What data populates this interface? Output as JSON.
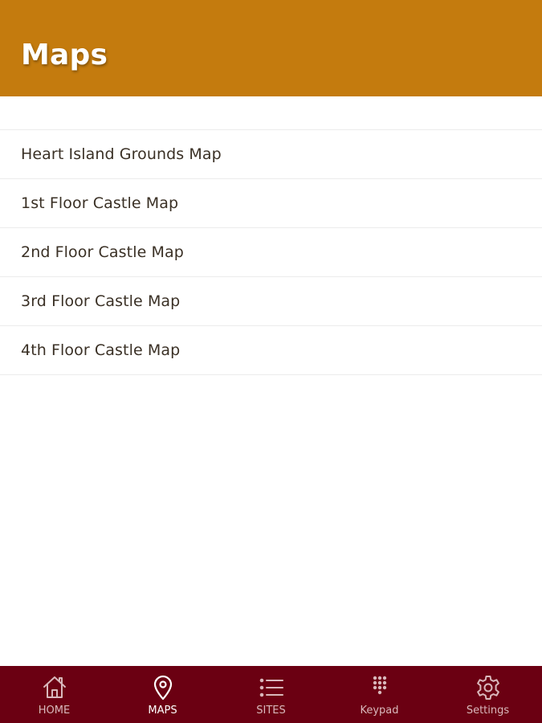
{
  "header": {
    "title": "Maps"
  },
  "maps": {
    "items": [
      {
        "label": "Heart Island Grounds Map"
      },
      {
        "label": "1st Floor Castle Map"
      },
      {
        "label": "2nd Floor Castle Map"
      },
      {
        "label": "3rd Floor Castle Map"
      },
      {
        "label": "4th Floor Castle Map"
      }
    ]
  },
  "tabbar": {
    "active": "maps",
    "tabs": [
      {
        "key": "home",
        "label": "HOME",
        "icon": "home-icon"
      },
      {
        "key": "maps",
        "label": "MAPS",
        "icon": "map-pin-icon"
      },
      {
        "key": "sites",
        "label": "SITES",
        "icon": "list-icon"
      },
      {
        "key": "keypad",
        "label": "Keypad",
        "icon": "keypad-icon"
      },
      {
        "key": "settings",
        "label": "Settings",
        "icon": "gear-icon"
      }
    ]
  },
  "colors": {
    "header_background": "#c47b0e",
    "tabbar_background": "#6b0012",
    "tab_active": "#ffffff",
    "tab_inactive": "#d9b8bc",
    "list_text": "#3a3025"
  }
}
